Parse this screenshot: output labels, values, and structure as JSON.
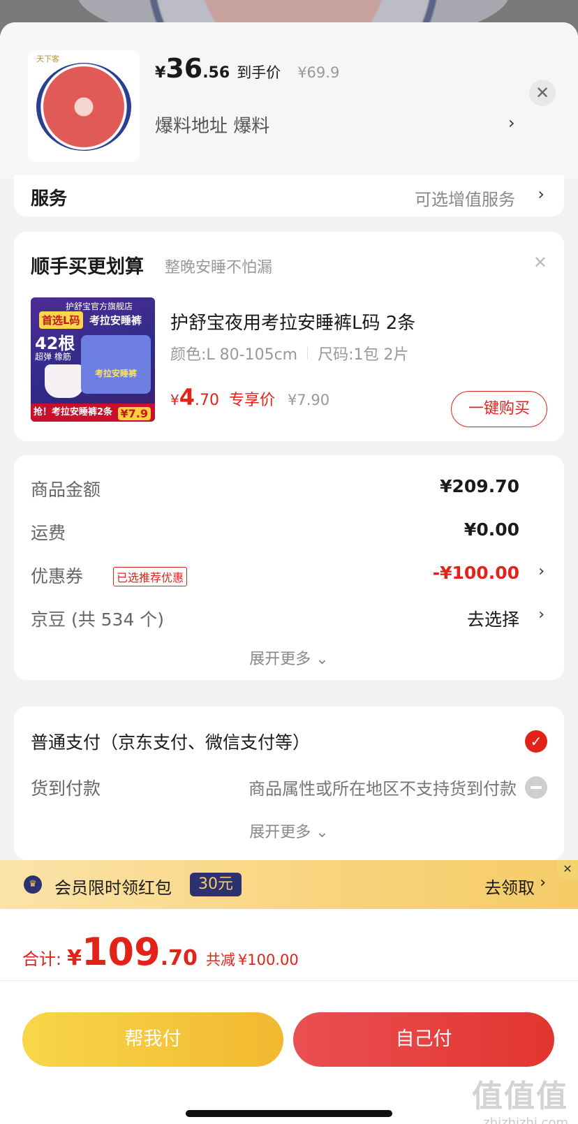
{
  "header": {
    "price_yen": "¥",
    "price_int": "36",
    "price_dec": ".56",
    "price_tag": "到手价",
    "orig_price": "¥69.9",
    "address_label": "爆料地址  爆料",
    "thumb_brand": "天下客"
  },
  "service": {
    "label": "服务",
    "value": "可选增值服务"
  },
  "upsell": {
    "title": "顺手买更划算",
    "subtitle": "整晚安睡不怕漏",
    "product_name": "护舒宝夜用考拉安睡裤L码 2条",
    "spec_color": "颜色:L 80-105cm",
    "spec_size": "尺码:1包 2片",
    "price_yen": "¥",
    "price_int": "4",
    "price_dec": ".70",
    "price_tag": "专享价",
    "orig_price": "¥7.90",
    "buy_label": "一键购买",
    "img": {
      "store": "护舒宝官方旗舰店",
      "badge1": "首选L码",
      "badge2": "考拉安睡裤",
      "num": "42根",
      "small": "超弹 橡筋",
      "pack_text": "考拉安睡裤",
      "strip": "抢！考拉安睡裤2条",
      "price": "¥7.9"
    }
  },
  "summary": {
    "goods_label": "商品金额",
    "goods_value": "¥209.70",
    "ship_label": "运费",
    "ship_value": "¥0.00",
    "coupon_label": "优惠券",
    "coupon_tag": "已选推荐优惠",
    "coupon_value": "-¥100.00",
    "bean_label": "京豆 (共 534 个)",
    "bean_value": "去选择",
    "more": "展开更多"
  },
  "payment": {
    "normal": "普通支付（京东支付、微信支付等）",
    "cod": "货到付款",
    "cod_note": "商品属性或所在地区不支持货到付款",
    "more": "展开更多"
  },
  "banner": {
    "text": "会员限时领红包",
    "amount": "30元",
    "action": "去领取"
  },
  "footer": {
    "total_label": "合计:",
    "total_yen": "¥",
    "total_int": "109",
    "total_dec": ".70",
    "reduce_label": "共减",
    "reduce_amount": "¥100.00",
    "help_pay": "帮我付",
    "self_pay": "自己付"
  },
  "watermark": {
    "big": "值值值",
    "small": "zhizhizhi.com"
  },
  "colors": {
    "accent": "#e2231a",
    "gold": "#f2b830",
    "navy": "#2c3270"
  }
}
